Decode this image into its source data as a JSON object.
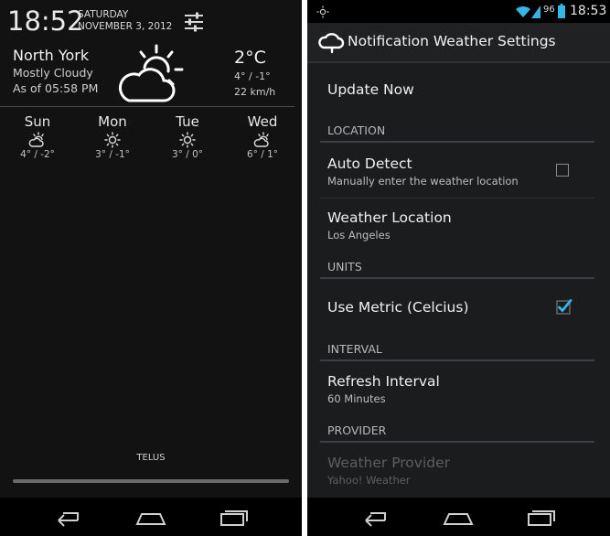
{
  "left": {
    "time": "18:52",
    "day": "SATURDAY",
    "date": "NOVEMBER 3, 2012",
    "location": "North York",
    "condition": "Mostly Cloudy",
    "as_of": "As of 05:58 PM",
    "temperature": "2°C",
    "hi_lo": "4° / -1°",
    "wind": "22 km/h",
    "forecast": [
      {
        "day": "Sun",
        "icon": "partly-cloudy-icon",
        "temps": "4° / -2°"
      },
      {
        "day": "Mon",
        "icon": "sun-icon",
        "temps": "3° / -1°"
      },
      {
        "day": "Tue",
        "icon": "sun-icon",
        "temps": "3° / 0°"
      },
      {
        "day": "Wed",
        "icon": "partly-cloudy-icon",
        "temps": "6° / 1°"
      }
    ],
    "carrier": "TELUS"
  },
  "right": {
    "status": {
      "battery": "96",
      "clock": "18:53"
    },
    "title": "Notification Weather Settings",
    "update_now": "Update Now",
    "sections": {
      "location": "LOCATION",
      "units": "UNITS",
      "interval": "INTERVAL",
      "provider": "PROVIDER"
    },
    "auto_detect": {
      "title": "Auto Detect",
      "summary": "Manually enter the weather location",
      "checked": false
    },
    "weather_location": {
      "title": "Weather Location",
      "summary": "Los Angeles"
    },
    "use_metric": {
      "title": "Use Metric (Celcius)",
      "checked": true
    },
    "refresh_interval": {
      "title": "Refresh Interval",
      "summary": "60 Minutes"
    },
    "weather_provider": {
      "title": "Weather Provider",
      "summary": "Yahoo! Weather",
      "enabled": false
    }
  },
  "colors": {
    "accent": "#33b5e5",
    "background": "#121212",
    "settings_bg": "#1a1c1e"
  }
}
